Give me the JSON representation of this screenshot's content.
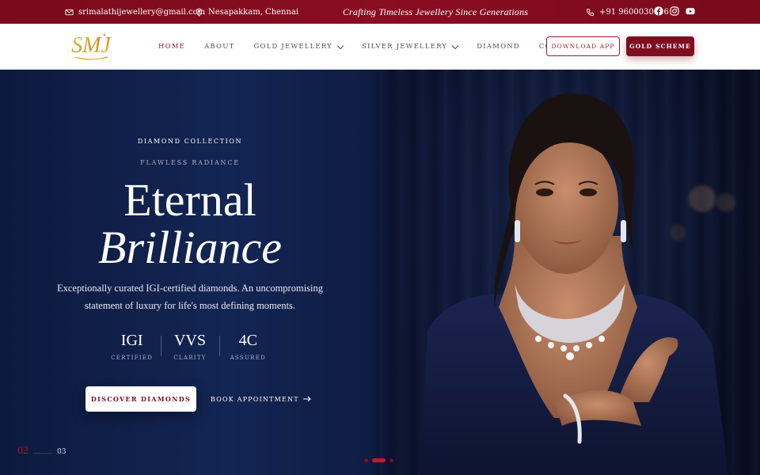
{
  "topbar": {
    "email": "srimalathijewellery@gmail.com",
    "location": "Nesapakkam, Chennai",
    "tagline": "Crafting Timeless Jewellery Since Generations",
    "phone": "+91 9600030916",
    "social": [
      "facebook-icon",
      "instagram-icon",
      "youtube-icon"
    ]
  },
  "navbar": {
    "logo_text": "SMJ",
    "items": [
      {
        "label": "HOME",
        "active": true
      },
      {
        "label": "ABOUT"
      },
      {
        "label": "GOLD JEWELLERY",
        "dropdown": true
      },
      {
        "label": "SILVER JEWELLERY",
        "dropdown": true
      },
      {
        "label": "DIAMOND"
      },
      {
        "label": "CONTACT"
      }
    ],
    "download_app": "DOWNLOAD APP",
    "gold_scheme": "GOLD SCHEME"
  },
  "hero": {
    "eyebrow": "DIAMOND COLLECTION",
    "sub_eyebrow": "FLAWLESS RADIANCE",
    "title_line1": "Eternal",
    "title_line2": "Brilliance",
    "description": "Exceptionally curated IGI-certified diamonds. An uncompromising statement of luxury for life's most defining moments.",
    "stats": [
      {
        "value": "IGI",
        "label": "CERTIFIED"
      },
      {
        "value": "VVS",
        "label": "CLARITY"
      },
      {
        "value": "4C",
        "label": "ASSURED"
      }
    ],
    "primary_cta": "DISCOVER DIAMONDS",
    "secondary_cta": "BOOK APPOINTMENT",
    "slide_current": "02",
    "slide_total": "03",
    "slide_count": 3,
    "active_slide": 2
  },
  "colors": {
    "brand": "#7e0d20",
    "accent": "#c4162e",
    "hero_bg": "#132553",
    "gold": "#d4a93a"
  }
}
